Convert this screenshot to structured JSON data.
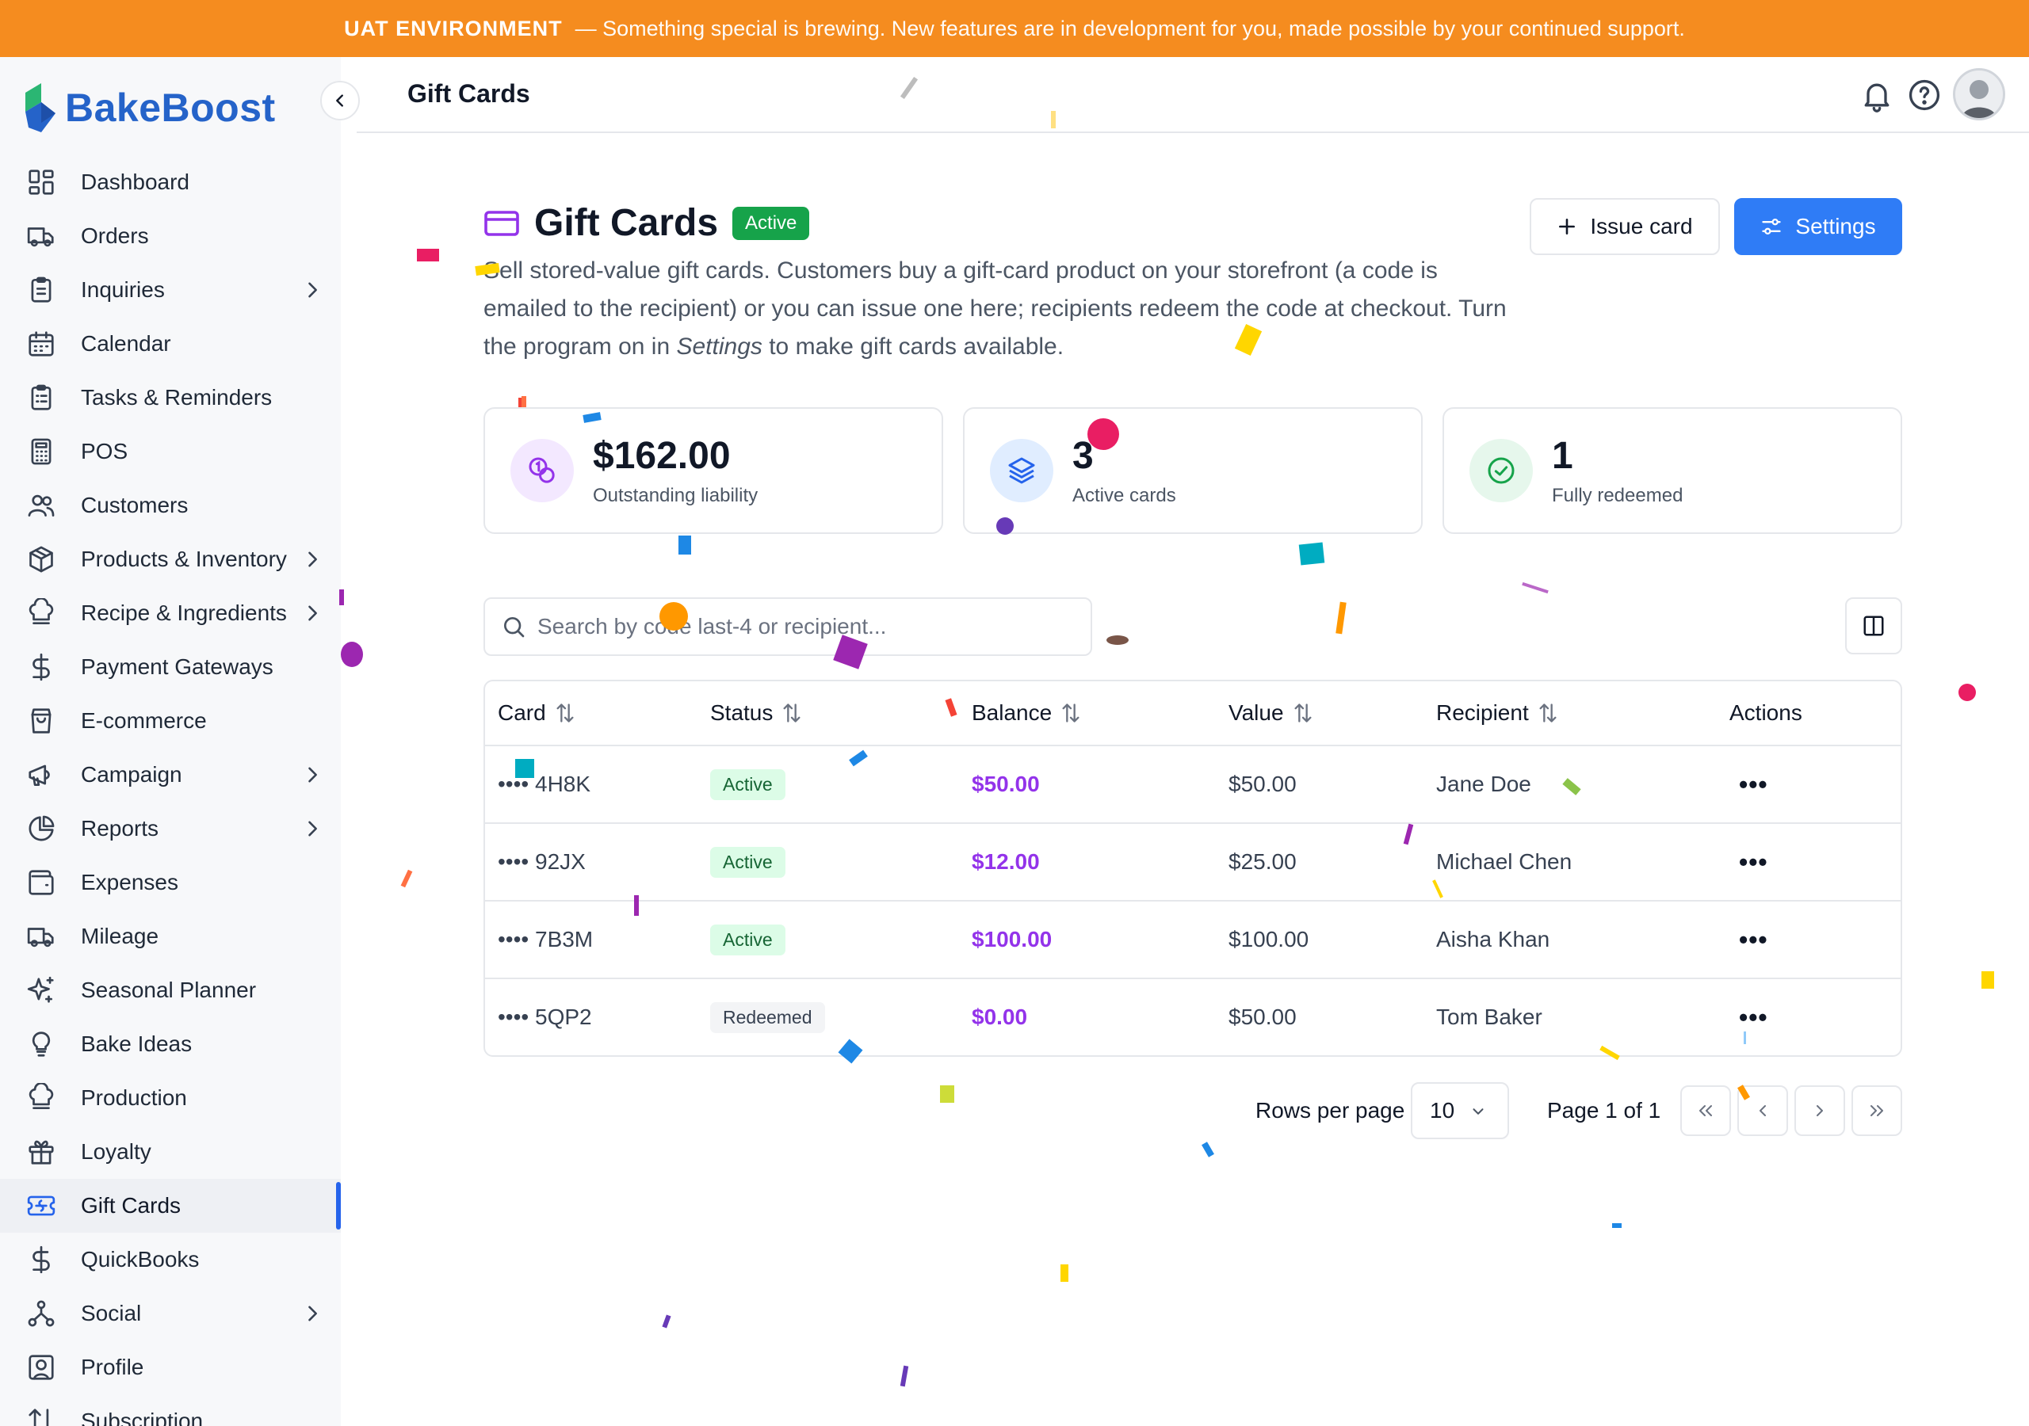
{
  "banner": {
    "env": "UAT ENVIRONMENT",
    "message": "— Something special is brewing. New features are in development for you, made possible by your continued support."
  },
  "brand": {
    "name": "BakeBoost",
    "color": "#2563c9"
  },
  "sidebar": {
    "items": [
      {
        "label": "Dashboard",
        "icon": "dashboard-icon"
      },
      {
        "label": "Orders",
        "icon": "truck-icon"
      },
      {
        "label": "Inquiries",
        "icon": "clipboard-icon",
        "has_submenu": true
      },
      {
        "label": "Calendar",
        "icon": "calendar-icon"
      },
      {
        "label": "Tasks & Reminders",
        "icon": "clipboard-list-icon"
      },
      {
        "label": "POS",
        "icon": "calculator-icon"
      },
      {
        "label": "Customers",
        "icon": "users-icon"
      },
      {
        "label": "Products & Inventory",
        "icon": "package-icon",
        "has_submenu": true
      },
      {
        "label": "Recipe & Ingredients",
        "icon": "chef-hat-icon",
        "has_submenu": true
      },
      {
        "label": "Payment Gateways",
        "icon": "dollar-icon"
      },
      {
        "label": "E-commerce",
        "icon": "shopping-bag-icon"
      },
      {
        "label": "Campaign",
        "icon": "megaphone-icon",
        "has_submenu": true
      },
      {
        "label": "Reports",
        "icon": "pie-chart-icon",
        "has_submenu": true
      },
      {
        "label": "Expenses",
        "icon": "wallet-icon"
      },
      {
        "label": "Mileage",
        "icon": "truck-icon"
      },
      {
        "label": "Seasonal Planner",
        "icon": "sparkles-icon"
      },
      {
        "label": "Bake Ideas",
        "icon": "lightbulb-icon"
      },
      {
        "label": "Production",
        "icon": "chef-hat-icon"
      },
      {
        "label": "Loyalty",
        "icon": "gift-icon"
      },
      {
        "label": "Gift Cards",
        "icon": "ticket-icon",
        "active": true
      },
      {
        "label": "QuickBooks",
        "icon": "dollar-icon"
      },
      {
        "label": "Social",
        "icon": "share-network-icon",
        "has_submenu": true
      },
      {
        "label": "Profile",
        "icon": "user-square-icon"
      },
      {
        "label": "Subscription",
        "icon": "sort-icon"
      }
    ]
  },
  "topbar": {
    "title": "Gift Cards"
  },
  "page": {
    "title": "Gift Cards",
    "status_badge": "Active",
    "description_1": "Sell stored-value gift cards. Customers buy a gift-card product on your storefront (a code is emailed to the recipient) or you can issue one here; recipients redeem the code at checkout. Turn the program on in ",
    "description_em": "Settings",
    "description_2": " to make gift cards available.",
    "issue_button": "Issue card",
    "settings_button": "Settings"
  },
  "stats": [
    {
      "value": "$162.00",
      "label": "Outstanding liability",
      "icon": "coins-icon",
      "bg": "#f3e8ff",
      "fg": "#9333ea"
    },
    {
      "value": "3",
      "label": "Active cards",
      "icon": "layers-icon",
      "bg": "#e0edff",
      "fg": "#2563eb"
    },
    {
      "value": "1",
      "label": "Fully redeemed",
      "icon": "check-circle-icon",
      "bg": "#e6f7ec",
      "fg": "#16a34a"
    }
  ],
  "search": {
    "placeholder": "Search by code last-4 or recipient..."
  },
  "table": {
    "columns": [
      "Card",
      "Status",
      "Balance",
      "Value",
      "Recipient",
      "Actions"
    ],
    "rows": [
      {
        "card": "•••• 4H8K",
        "status": "Active",
        "balance": "$50.00",
        "value": "$50.00",
        "recipient": "Jane Doe"
      },
      {
        "card": "•••• 92JX",
        "status": "Active",
        "balance": "$12.00",
        "value": "$25.00",
        "recipient": "Michael Chen"
      },
      {
        "card": "•••• 7B3M",
        "status": "Active",
        "balance": "$100.00",
        "value": "$100.00",
        "recipient": "Aisha Khan"
      },
      {
        "card": "•••• 5QP2",
        "status": "Redeemed",
        "balance": "$0.00",
        "value": "$50.00",
        "recipient": "Tom Baker"
      }
    ],
    "actions_label": "•••"
  },
  "pagination": {
    "rows_per_page_label": "Rows per page",
    "rows_per_page": "10",
    "page_info": "Page 1 of 1"
  },
  "colors": {
    "banner": "#f58c1f",
    "accent": "#2f7cf6",
    "balance": "#9333ea",
    "active_badge": "#16a34a"
  }
}
